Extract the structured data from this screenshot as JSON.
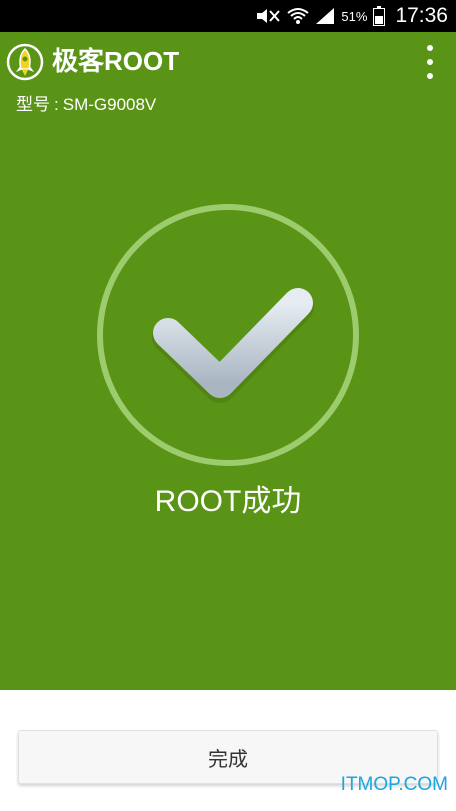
{
  "status_bar": {
    "battery_percent": "51%",
    "time": "17:36",
    "icons": [
      "mute-icon",
      "wifi-icon",
      "signal-icon",
      "battery-icon"
    ]
  },
  "header": {
    "app_name": "极客ROOT",
    "logo_icon": "rocket-logo-icon",
    "menu_icon": "more-vert-icon"
  },
  "device": {
    "model_label": "型号",
    "separator": ":",
    "model_value": "SM-G9008V"
  },
  "result": {
    "icon": "check-icon",
    "message": "ROOT成功"
  },
  "actions": {
    "done_label": "完成"
  },
  "watermark": "ITMOP.COM",
  "colors": {
    "primary_green": "#5a9416",
    "ring": "#9ccc6e",
    "check": "#c9d3dc",
    "watermark": "#1aa6de"
  }
}
